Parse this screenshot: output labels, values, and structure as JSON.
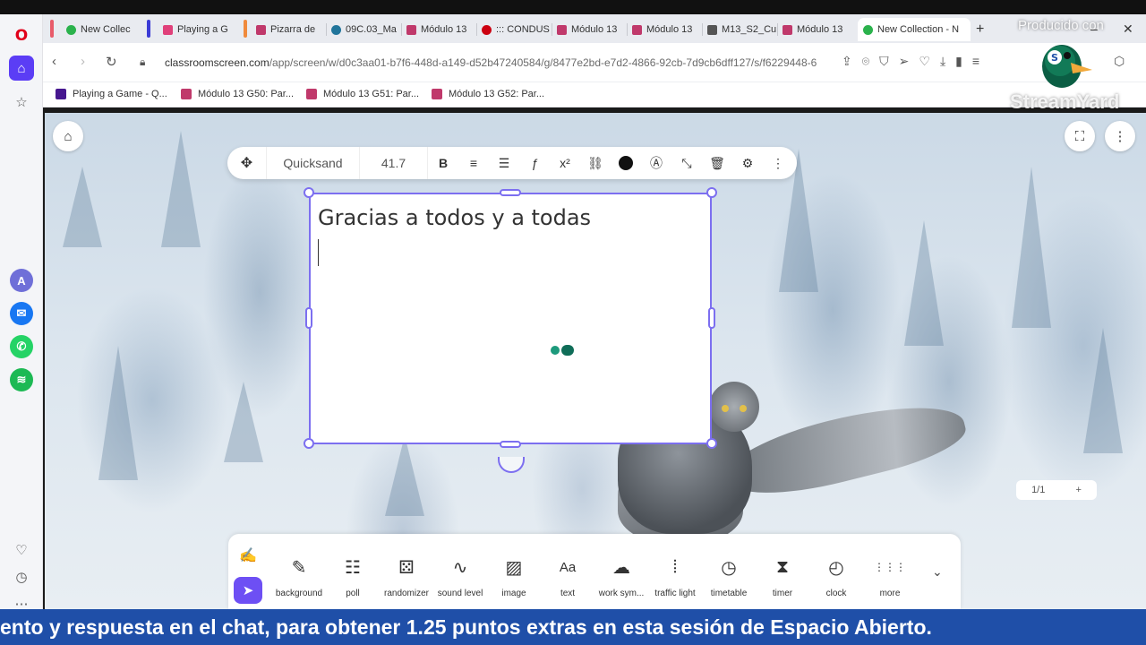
{
  "tabs": [
    {
      "label": "New Collec",
      "fav": "#2bb24c"
    },
    {
      "label": "Playing a G",
      "fav": "#e0407a"
    },
    {
      "label": "Pizarra de",
      "fav": "#c0396b"
    },
    {
      "label": "09C.03_Ma",
      "fav": "#21759b"
    },
    {
      "label": "Módulo 13",
      "fav": "#c0396b"
    },
    {
      "label": "::: CONDUS",
      "fav": "#cc0010"
    },
    {
      "label": "Módulo 13",
      "fav": "#c0396b"
    },
    {
      "label": "Módulo 13",
      "fav": "#c0396b"
    },
    {
      "label": "M13_S2_Cu",
      "fav": "#555555"
    },
    {
      "label": "Módulo 13",
      "fav": "#c0396b"
    },
    {
      "label": "New Collection - N",
      "fav": "#2bb24c"
    }
  ],
  "address": {
    "url_host": "classroomscreen.com",
    "url_path": "/app/screen/w/d0c3aa01-b7f6-448d-a149-d52b47240584/g/8477e2bd-e7d2-4866-92cb-7d9cb6dff127/s/f6229448-6"
  },
  "bookmarks": [
    {
      "label": "Playing a Game - Q...",
      "fav": "#46178f"
    },
    {
      "label": "Módulo 13 G50: Par...",
      "fav": "#c0396b"
    },
    {
      "label": "Módulo 13 G51: Par...",
      "fav": "#c0396b"
    },
    {
      "label": "Módulo 13 G52: Par...",
      "fav": "#c0396b"
    }
  ],
  "text_toolbar": {
    "font": "Quicksand",
    "size": "41.7"
  },
  "textbox": {
    "content": "Gracias a todos y a todas"
  },
  "tools": [
    {
      "label": "background",
      "icon": "✎"
    },
    {
      "label": "poll",
      "icon": "☷"
    },
    {
      "label": "randomizer",
      "icon": "⚄"
    },
    {
      "label": "sound level",
      "icon": "∿"
    },
    {
      "label": "image",
      "icon": "▨"
    },
    {
      "label": "text",
      "icon": "Aa"
    },
    {
      "label": "work sym...",
      "icon": "☁"
    },
    {
      "label": "traffic light",
      "icon": "⦙"
    },
    {
      "label": "timetable",
      "icon": "◷"
    },
    {
      "label": "timer",
      "icon": "⧗"
    },
    {
      "label": "clock",
      "icon": "◴"
    },
    {
      "label": "more",
      "icon": "⋮⋮⋮"
    }
  ],
  "page_indicator": {
    "current": "1/1",
    "add": "+"
  },
  "overlay": {
    "producido": "Producido con",
    "brand": "StreamYard"
  },
  "ticker": {
    "text": "ento y respuesta en el chat, para obtener 1.25 puntos extras en esta sesión de Espacio Abierto."
  },
  "colors": {
    "accent": "#6d4ff4",
    "selection": "#7c6ff0",
    "ticker_bg": "#1f4fa8"
  }
}
